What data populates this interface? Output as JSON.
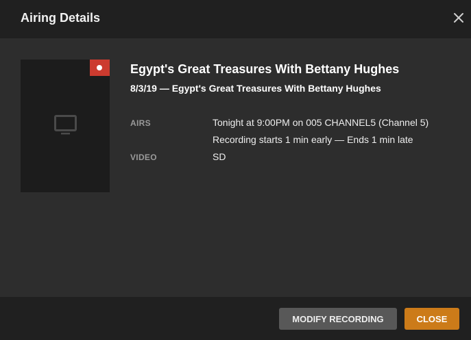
{
  "dialog": {
    "title": "Airing Details",
    "close_icon": "close-icon"
  },
  "airing": {
    "poster_icon": "tv-icon",
    "recording_badge_icon": "record-icon",
    "recording_badge_color": "#cc3b2f",
    "show_title": "Egypt's Great Treasures With Bettany Hughes",
    "episode_title": "8/3/19 — Egypt's Great Treasures With Bettany Hughes",
    "details": {
      "airs_label": "AIRS",
      "airs_value": "Tonight at 9:00PM on 005 CHANNEL5 (Channel 5)",
      "recording_value": "Recording starts 1 min early — Ends 1 min late",
      "video_label": "VIDEO",
      "video_value": "SD"
    }
  },
  "footer": {
    "modify_label": "MODIFY RECORDING",
    "close_label": "CLOSE",
    "close_color": "#cc7b19"
  }
}
